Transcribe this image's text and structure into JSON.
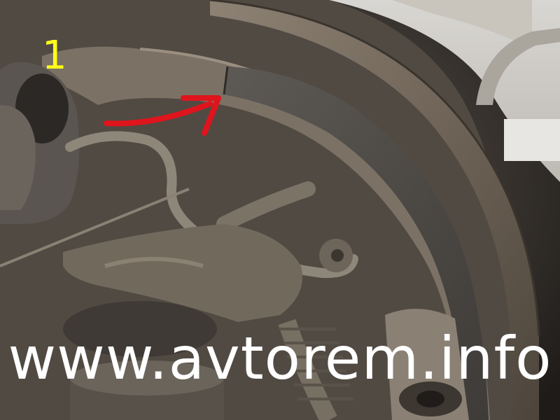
{
  "photo": {
    "subject": "drum brake shoe assembly"
  },
  "callout": {
    "number": "1",
    "number_color": "#ffff1a",
    "arrow_color": "#e0141c"
  },
  "watermark": {
    "text": "www.avtorem.info",
    "color": "#ffffff"
  }
}
